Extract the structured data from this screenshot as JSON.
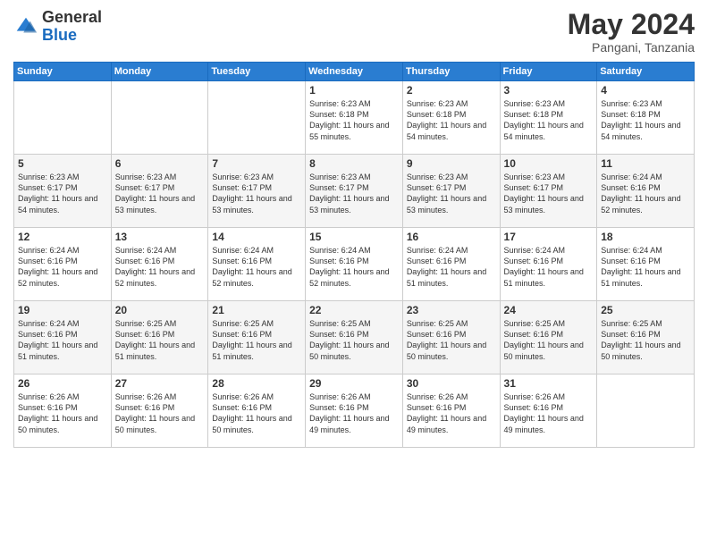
{
  "logo": {
    "general": "General",
    "blue": "Blue"
  },
  "title": {
    "month_year": "May 2024",
    "location": "Pangani, Tanzania"
  },
  "weekdays": [
    "Sunday",
    "Monday",
    "Tuesday",
    "Wednesday",
    "Thursday",
    "Friday",
    "Saturday"
  ],
  "weeks": [
    [
      {
        "day": "",
        "sunrise": "",
        "sunset": "",
        "daylight": ""
      },
      {
        "day": "",
        "sunrise": "",
        "sunset": "",
        "daylight": ""
      },
      {
        "day": "",
        "sunrise": "",
        "sunset": "",
        "daylight": ""
      },
      {
        "day": "1",
        "sunrise": "Sunrise: 6:23 AM",
        "sunset": "Sunset: 6:18 PM",
        "daylight": "Daylight: 11 hours and 55 minutes."
      },
      {
        "day": "2",
        "sunrise": "Sunrise: 6:23 AM",
        "sunset": "Sunset: 6:18 PM",
        "daylight": "Daylight: 11 hours and 54 minutes."
      },
      {
        "day": "3",
        "sunrise": "Sunrise: 6:23 AM",
        "sunset": "Sunset: 6:18 PM",
        "daylight": "Daylight: 11 hours and 54 minutes."
      },
      {
        "day": "4",
        "sunrise": "Sunrise: 6:23 AM",
        "sunset": "Sunset: 6:18 PM",
        "daylight": "Daylight: 11 hours and 54 minutes."
      }
    ],
    [
      {
        "day": "5",
        "sunrise": "Sunrise: 6:23 AM",
        "sunset": "Sunset: 6:17 PM",
        "daylight": "Daylight: 11 hours and 54 minutes."
      },
      {
        "day": "6",
        "sunrise": "Sunrise: 6:23 AM",
        "sunset": "Sunset: 6:17 PM",
        "daylight": "Daylight: 11 hours and 53 minutes."
      },
      {
        "day": "7",
        "sunrise": "Sunrise: 6:23 AM",
        "sunset": "Sunset: 6:17 PM",
        "daylight": "Daylight: 11 hours and 53 minutes."
      },
      {
        "day": "8",
        "sunrise": "Sunrise: 6:23 AM",
        "sunset": "Sunset: 6:17 PM",
        "daylight": "Daylight: 11 hours and 53 minutes."
      },
      {
        "day": "9",
        "sunrise": "Sunrise: 6:23 AM",
        "sunset": "Sunset: 6:17 PM",
        "daylight": "Daylight: 11 hours and 53 minutes."
      },
      {
        "day": "10",
        "sunrise": "Sunrise: 6:23 AM",
        "sunset": "Sunset: 6:17 PM",
        "daylight": "Daylight: 11 hours and 53 minutes."
      },
      {
        "day": "11",
        "sunrise": "Sunrise: 6:24 AM",
        "sunset": "Sunset: 6:16 PM",
        "daylight": "Daylight: 11 hours and 52 minutes."
      }
    ],
    [
      {
        "day": "12",
        "sunrise": "Sunrise: 6:24 AM",
        "sunset": "Sunset: 6:16 PM",
        "daylight": "Daylight: 11 hours and 52 minutes."
      },
      {
        "day": "13",
        "sunrise": "Sunrise: 6:24 AM",
        "sunset": "Sunset: 6:16 PM",
        "daylight": "Daylight: 11 hours and 52 minutes."
      },
      {
        "day": "14",
        "sunrise": "Sunrise: 6:24 AM",
        "sunset": "Sunset: 6:16 PM",
        "daylight": "Daylight: 11 hours and 52 minutes."
      },
      {
        "day": "15",
        "sunrise": "Sunrise: 6:24 AM",
        "sunset": "Sunset: 6:16 PM",
        "daylight": "Daylight: 11 hours and 52 minutes."
      },
      {
        "day": "16",
        "sunrise": "Sunrise: 6:24 AM",
        "sunset": "Sunset: 6:16 PM",
        "daylight": "Daylight: 11 hours and 51 minutes."
      },
      {
        "day": "17",
        "sunrise": "Sunrise: 6:24 AM",
        "sunset": "Sunset: 6:16 PM",
        "daylight": "Daylight: 11 hours and 51 minutes."
      },
      {
        "day": "18",
        "sunrise": "Sunrise: 6:24 AM",
        "sunset": "Sunset: 6:16 PM",
        "daylight": "Daylight: 11 hours and 51 minutes."
      }
    ],
    [
      {
        "day": "19",
        "sunrise": "Sunrise: 6:24 AM",
        "sunset": "Sunset: 6:16 PM",
        "daylight": "Daylight: 11 hours and 51 minutes."
      },
      {
        "day": "20",
        "sunrise": "Sunrise: 6:25 AM",
        "sunset": "Sunset: 6:16 PM",
        "daylight": "Daylight: 11 hours and 51 minutes."
      },
      {
        "day": "21",
        "sunrise": "Sunrise: 6:25 AM",
        "sunset": "Sunset: 6:16 PM",
        "daylight": "Daylight: 11 hours and 51 minutes."
      },
      {
        "day": "22",
        "sunrise": "Sunrise: 6:25 AM",
        "sunset": "Sunset: 6:16 PM",
        "daylight": "Daylight: 11 hours and 50 minutes."
      },
      {
        "day": "23",
        "sunrise": "Sunrise: 6:25 AM",
        "sunset": "Sunset: 6:16 PM",
        "daylight": "Daylight: 11 hours and 50 minutes."
      },
      {
        "day": "24",
        "sunrise": "Sunrise: 6:25 AM",
        "sunset": "Sunset: 6:16 PM",
        "daylight": "Daylight: 11 hours and 50 minutes."
      },
      {
        "day": "25",
        "sunrise": "Sunrise: 6:25 AM",
        "sunset": "Sunset: 6:16 PM",
        "daylight": "Daylight: 11 hours and 50 minutes."
      }
    ],
    [
      {
        "day": "26",
        "sunrise": "Sunrise: 6:26 AM",
        "sunset": "Sunset: 6:16 PM",
        "daylight": "Daylight: 11 hours and 50 minutes."
      },
      {
        "day": "27",
        "sunrise": "Sunrise: 6:26 AM",
        "sunset": "Sunset: 6:16 PM",
        "daylight": "Daylight: 11 hours and 50 minutes."
      },
      {
        "day": "28",
        "sunrise": "Sunrise: 6:26 AM",
        "sunset": "Sunset: 6:16 PM",
        "daylight": "Daylight: 11 hours and 50 minutes."
      },
      {
        "day": "29",
        "sunrise": "Sunrise: 6:26 AM",
        "sunset": "Sunset: 6:16 PM",
        "daylight": "Daylight: 11 hours and 49 minutes."
      },
      {
        "day": "30",
        "sunrise": "Sunrise: 6:26 AM",
        "sunset": "Sunset: 6:16 PM",
        "daylight": "Daylight: 11 hours and 49 minutes."
      },
      {
        "day": "31",
        "sunrise": "Sunrise: 6:26 AM",
        "sunset": "Sunset: 6:16 PM",
        "daylight": "Daylight: 11 hours and 49 minutes."
      },
      {
        "day": "",
        "sunrise": "",
        "sunset": "",
        "daylight": ""
      }
    ]
  ]
}
